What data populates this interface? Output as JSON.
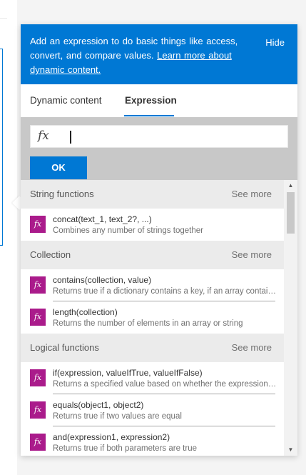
{
  "banner": {
    "text": "Add an expression to do basic things like access, convert, and compare values.",
    "link": "Learn more about dynamic content.",
    "hide": "Hide"
  },
  "tabs": [
    {
      "label": "Dynamic content",
      "active": false
    },
    {
      "label": "Expression",
      "active": true
    }
  ],
  "expression": {
    "value": "",
    "fx": "fx",
    "ok_label": "OK"
  },
  "sections": [
    {
      "title": "String functions",
      "see_more": "See more",
      "items": [
        {
          "name": "concat(text_1, text_2?, ...)",
          "desc": "Combines any number of strings together"
        }
      ]
    },
    {
      "title": "Collection",
      "see_more": "See more",
      "items": [
        {
          "name": "contains(collection, value)",
          "desc": "Returns true if a dictionary contains a key, if an array contains a value"
        },
        {
          "name": "length(collection)",
          "desc": "Returns the number of elements in an array or string"
        }
      ]
    },
    {
      "title": "Logical functions",
      "see_more": "See more",
      "items": [
        {
          "name": "if(expression, valueIfTrue, valueIfFalse)",
          "desc": "Returns a specified value based on whether the expression is true or false"
        },
        {
          "name": "equals(object1, object2)",
          "desc": "Returns true if two values are equal"
        },
        {
          "name": "and(expression1, expression2)",
          "desc": "Returns true if both parameters are true"
        }
      ]
    }
  ],
  "colors": {
    "accent": "#0078d4",
    "fx_icon": "#aa1b8b",
    "section_bg": "#ebebeb"
  }
}
